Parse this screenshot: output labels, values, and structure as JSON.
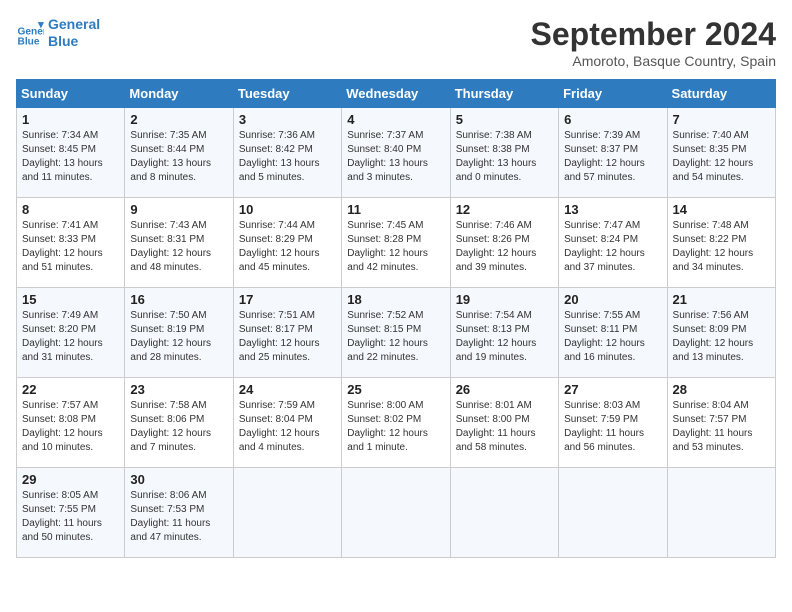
{
  "logo": {
    "line1": "General",
    "line2": "Blue"
  },
  "title": "September 2024",
  "location": "Amoroto, Basque Country, Spain",
  "days_of_week": [
    "Sunday",
    "Monday",
    "Tuesday",
    "Wednesday",
    "Thursday",
    "Friday",
    "Saturday"
  ],
  "weeks": [
    [
      {
        "day": "1",
        "sunrise": "Sunrise: 7:34 AM",
        "sunset": "Sunset: 8:45 PM",
        "daylight": "Daylight: 13 hours and 11 minutes."
      },
      {
        "day": "2",
        "sunrise": "Sunrise: 7:35 AM",
        "sunset": "Sunset: 8:44 PM",
        "daylight": "Daylight: 13 hours and 8 minutes."
      },
      {
        "day": "3",
        "sunrise": "Sunrise: 7:36 AM",
        "sunset": "Sunset: 8:42 PM",
        "daylight": "Daylight: 13 hours and 5 minutes."
      },
      {
        "day": "4",
        "sunrise": "Sunrise: 7:37 AM",
        "sunset": "Sunset: 8:40 PM",
        "daylight": "Daylight: 13 hours and 3 minutes."
      },
      {
        "day": "5",
        "sunrise": "Sunrise: 7:38 AM",
        "sunset": "Sunset: 8:38 PM",
        "daylight": "Daylight: 13 hours and 0 minutes."
      },
      {
        "day": "6",
        "sunrise": "Sunrise: 7:39 AM",
        "sunset": "Sunset: 8:37 PM",
        "daylight": "Daylight: 12 hours and 57 minutes."
      },
      {
        "day": "7",
        "sunrise": "Sunrise: 7:40 AM",
        "sunset": "Sunset: 8:35 PM",
        "daylight": "Daylight: 12 hours and 54 minutes."
      }
    ],
    [
      {
        "day": "8",
        "sunrise": "Sunrise: 7:41 AM",
        "sunset": "Sunset: 8:33 PM",
        "daylight": "Daylight: 12 hours and 51 minutes."
      },
      {
        "day": "9",
        "sunrise": "Sunrise: 7:43 AM",
        "sunset": "Sunset: 8:31 PM",
        "daylight": "Daylight: 12 hours and 48 minutes."
      },
      {
        "day": "10",
        "sunrise": "Sunrise: 7:44 AM",
        "sunset": "Sunset: 8:29 PM",
        "daylight": "Daylight: 12 hours and 45 minutes."
      },
      {
        "day": "11",
        "sunrise": "Sunrise: 7:45 AM",
        "sunset": "Sunset: 8:28 PM",
        "daylight": "Daylight: 12 hours and 42 minutes."
      },
      {
        "day": "12",
        "sunrise": "Sunrise: 7:46 AM",
        "sunset": "Sunset: 8:26 PM",
        "daylight": "Daylight: 12 hours and 39 minutes."
      },
      {
        "day": "13",
        "sunrise": "Sunrise: 7:47 AM",
        "sunset": "Sunset: 8:24 PM",
        "daylight": "Daylight: 12 hours and 37 minutes."
      },
      {
        "day": "14",
        "sunrise": "Sunrise: 7:48 AM",
        "sunset": "Sunset: 8:22 PM",
        "daylight": "Daylight: 12 hours and 34 minutes."
      }
    ],
    [
      {
        "day": "15",
        "sunrise": "Sunrise: 7:49 AM",
        "sunset": "Sunset: 8:20 PM",
        "daylight": "Daylight: 12 hours and 31 minutes."
      },
      {
        "day": "16",
        "sunrise": "Sunrise: 7:50 AM",
        "sunset": "Sunset: 8:19 PM",
        "daylight": "Daylight: 12 hours and 28 minutes."
      },
      {
        "day": "17",
        "sunrise": "Sunrise: 7:51 AM",
        "sunset": "Sunset: 8:17 PM",
        "daylight": "Daylight: 12 hours and 25 minutes."
      },
      {
        "day": "18",
        "sunrise": "Sunrise: 7:52 AM",
        "sunset": "Sunset: 8:15 PM",
        "daylight": "Daylight: 12 hours and 22 minutes."
      },
      {
        "day": "19",
        "sunrise": "Sunrise: 7:54 AM",
        "sunset": "Sunset: 8:13 PM",
        "daylight": "Daylight: 12 hours and 19 minutes."
      },
      {
        "day": "20",
        "sunrise": "Sunrise: 7:55 AM",
        "sunset": "Sunset: 8:11 PM",
        "daylight": "Daylight: 12 hours and 16 minutes."
      },
      {
        "day": "21",
        "sunrise": "Sunrise: 7:56 AM",
        "sunset": "Sunset: 8:09 PM",
        "daylight": "Daylight: 12 hours and 13 minutes."
      }
    ],
    [
      {
        "day": "22",
        "sunrise": "Sunrise: 7:57 AM",
        "sunset": "Sunset: 8:08 PM",
        "daylight": "Daylight: 12 hours and 10 minutes."
      },
      {
        "day": "23",
        "sunrise": "Sunrise: 7:58 AM",
        "sunset": "Sunset: 8:06 PM",
        "daylight": "Daylight: 12 hours and 7 minutes."
      },
      {
        "day": "24",
        "sunrise": "Sunrise: 7:59 AM",
        "sunset": "Sunset: 8:04 PM",
        "daylight": "Daylight: 12 hours and 4 minutes."
      },
      {
        "day": "25",
        "sunrise": "Sunrise: 8:00 AM",
        "sunset": "Sunset: 8:02 PM",
        "daylight": "Daylight: 12 hours and 1 minute."
      },
      {
        "day": "26",
        "sunrise": "Sunrise: 8:01 AM",
        "sunset": "Sunset: 8:00 PM",
        "daylight": "Daylight: 11 hours and 58 minutes."
      },
      {
        "day": "27",
        "sunrise": "Sunrise: 8:03 AM",
        "sunset": "Sunset: 7:59 PM",
        "daylight": "Daylight: 11 hours and 56 minutes."
      },
      {
        "day": "28",
        "sunrise": "Sunrise: 8:04 AM",
        "sunset": "Sunset: 7:57 PM",
        "daylight": "Daylight: 11 hours and 53 minutes."
      }
    ],
    [
      {
        "day": "29",
        "sunrise": "Sunrise: 8:05 AM",
        "sunset": "Sunset: 7:55 PM",
        "daylight": "Daylight: 11 hours and 50 minutes."
      },
      {
        "day": "30",
        "sunrise": "Sunrise: 8:06 AM",
        "sunset": "Sunset: 7:53 PM",
        "daylight": "Daylight: 11 hours and 47 minutes."
      },
      null,
      null,
      null,
      null,
      null
    ]
  ]
}
